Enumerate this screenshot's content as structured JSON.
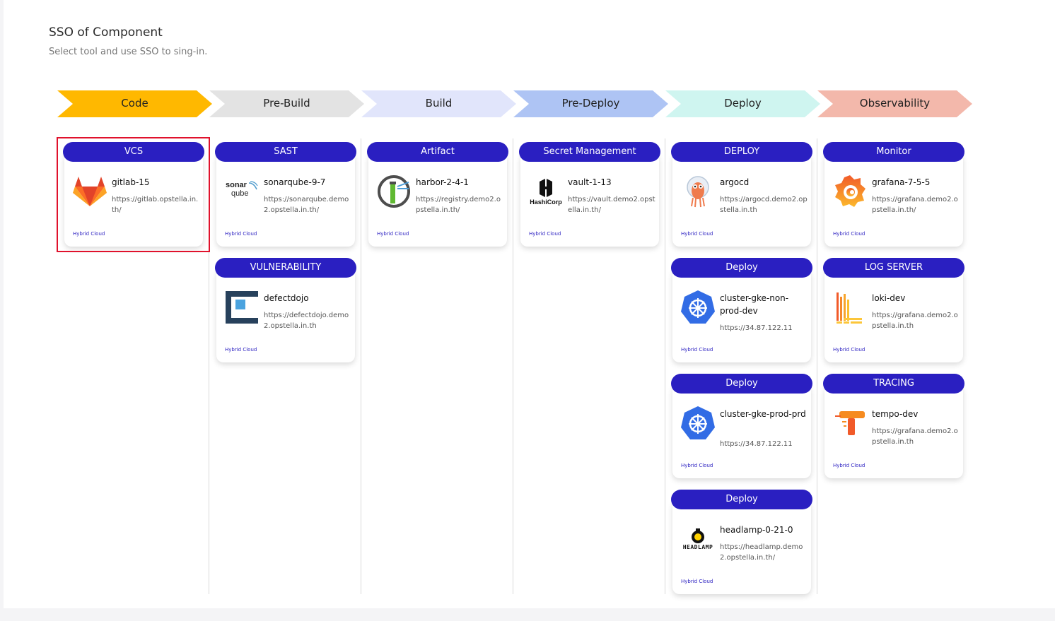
{
  "page": {
    "title": "SSO of Component",
    "subtitle": "Select tool and use SSO to sing-in."
  },
  "stages": [
    {
      "label": "Code",
      "color": "#ffb800"
    },
    {
      "label": "Pre-Build",
      "color": "#e3e3e3"
    },
    {
      "label": "Build",
      "color": "#e1e5fb"
    },
    {
      "label": "Pre-Deploy",
      "color": "#aec4f4"
    },
    {
      "label": "Deploy",
      "color": "#cff5f0"
    },
    {
      "label": "Observability",
      "color": "#f3b8ab"
    }
  ],
  "groups": {
    "vcs": {
      "header": "VCS",
      "name": "gitlab-15",
      "url": "https://gitlab.opstella.in.th/",
      "badge": "Hybrid Cloud"
    },
    "sast": {
      "header": "SAST",
      "name": "sonarqube-9-7",
      "url": "https://sonarqube.demo2.opstella.in.th/",
      "badge": "Hybrid Cloud"
    },
    "vulnerability": {
      "header": "VULNERABILITY",
      "name": "defectdojo",
      "url": "https://defectdojo.demo2.opstella.in.th",
      "badge": "Hybrid Cloud"
    },
    "artifact": {
      "header": "Artifact",
      "name": "harbor-2-4-1",
      "url": "https://registry.demo2.opstella.in.th/",
      "badge": "Hybrid Cloud"
    },
    "secret": {
      "header": "Secret Management",
      "name": "vault-1-13",
      "url": "https://vault.demo2.opstella.in.th/",
      "badge": "Hybrid Cloud",
      "logo_text": "HashiCorp"
    },
    "deploy_argocd": {
      "header": "DEPLOY",
      "name": "argocd",
      "url": "https://argocd.demo2.opstella.in.th",
      "badge": "Hybrid Cloud"
    },
    "deploy_nonprod": {
      "header": "Deploy",
      "name": "cluster-gke-non-prod-dev",
      "url": "https://34.87.122.11",
      "badge": "Hybrid Cloud"
    },
    "deploy_prod": {
      "header": "Deploy",
      "name": "cluster-gke-prod-prd",
      "url": "https://34.87.122.11",
      "badge": "Hybrid Cloud"
    },
    "deploy_headlamp": {
      "header": "Deploy",
      "name": "headlamp-0-21-0",
      "url": "https://headlamp.demo2.opstella.in.th/",
      "badge": "Hybrid Cloud",
      "logo_text": "HEADLAMP"
    },
    "monitor": {
      "header": "Monitor",
      "name": "grafana-7-5-5",
      "url": "https://grafana.demo2.opstella.in.th/",
      "badge": "Hybrid Cloud"
    },
    "log": {
      "header": "LOG SERVER",
      "name": "loki-dev",
      "url": "https://grafana.demo2.opstella.in.th",
      "badge": "Hybrid Cloud"
    },
    "tracing": {
      "header": "TRACING",
      "name": "tempo-dev",
      "url": "https://grafana.demo2.opstella.in.th",
      "badge": "Hybrid Cloud"
    }
  },
  "sonar_logo": {
    "top": "sonar",
    "bottom": "qube"
  },
  "colors": {
    "header": "#2a1fc1",
    "selection": "#e0122c"
  }
}
